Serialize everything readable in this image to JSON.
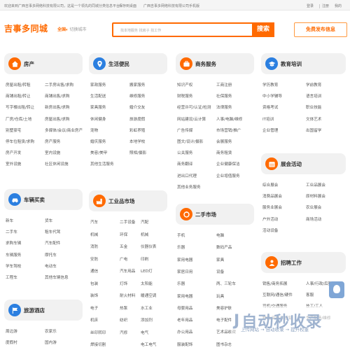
{
  "topbar": {
    "welcome": "欢迎来到广西吉事多网络科技有限公司，这是一个领先的同城分类信息平台！",
    "favorite": "保存到桌面",
    "mobile": "广西吉事多网络科技有限公司手机版",
    "login": "登录",
    "register": "注册",
    "my": "我的"
  },
  "header": {
    "logo": "吉事多同城",
    "city": "全国",
    "city_switch": "切换城市",
    "search_placeholder": "找本地服务 找房子 找工作",
    "search_button": "搜索",
    "post_button": "免费发布信息"
  },
  "cards": [
    {
      "title": "房产",
      "icon": "house-icon",
      "color": "#ff6a00",
      "items": [
        [
          "房屋出租/转租",
          "二手房出售/求购"
        ],
        [
          "商铺出租/转让",
          "商铺出售/求购"
        ],
        [
          "写字楼出租/转让",
          "新房出售/求购"
        ],
        [
          "厂房/仓库/土地",
          "房屋出售/求购"
        ],
        [
          "别墅豪宅",
          "多媒体/会议/商业房产"
        ],
        [
          "停车位租赁/求购",
          "房产服务"
        ],
        [
          "房产开发",
          "室内设施"
        ],
        [
          "室外设施",
          "社区休闲设施"
        ]
      ]
    },
    {
      "title": "生活便民",
      "icon": "location-icon",
      "color": "#2b7fe0",
      "items": [
        [
          "家政服务",
          "搬家服务"
        ],
        [
          "生活配送",
          "维修服务"
        ],
        [
          "家具服务",
          "婚介交友"
        ],
        [
          "休闲健身",
          "旅游度假"
        ],
        [
          "宠物",
          "彩虹养殖"
        ],
        [
          "婚庆服务",
          "本地学校"
        ],
        [
          "美容/美甲",
          "照相/摄影"
        ],
        [
          "其他生活服务",
          ""
        ]
      ]
    },
    {
      "title": "商务服务",
      "icon": "briefcase-icon",
      "color": "#ff6a00",
      "items": [
        [
          "知识产权",
          "工商注册"
        ],
        [
          "财税服务",
          "社保服务"
        ],
        [
          "经营许可/认证/检测",
          "法律服务"
        ],
        [
          "网站建设/云计算",
          "人事/电脑/维修"
        ],
        [
          "广告传媒",
          "市场营销/推广"
        ],
        [
          "图文/设计/摄影",
          "会展服务"
        ],
        [
          "公关服务",
          "商务租赁"
        ],
        [
          "商务翻译",
          "企业健康保洁"
        ],
        [
          "进出口代理",
          "企业增值服务"
        ],
        [
          "其他业务服务",
          ""
        ]
      ]
    },
    {
      "title": "教育培训",
      "icon": "graduation-icon",
      "color": "#2b7fe0",
      "items": [
        [
          "学历教育",
          "学前教育"
        ],
        [
          "中小学辅导",
          "语言培训"
        ],
        [
          "资格考试",
          "职业技能"
        ],
        [
          "IT培训",
          "文体艺术"
        ],
        [
          "企业管理",
          "出国留学"
        ]
      ]
    },
    {
      "title": "车辆买卖",
      "icon": "car-icon",
      "color": "#2b7fe0",
      "items": [
        [
          "新车",
          "货车"
        ],
        [
          "二手车",
          "租车代驾"
        ],
        [
          "求购车辆",
          "汽车配件"
        ],
        [
          "车辆服务",
          "摩托车"
        ],
        [
          "学车驾校",
          "电动车"
        ],
        [
          "工程车",
          "其他车辆信息"
        ]
      ]
    },
    {
      "title": "工业品市场",
      "icon": "factory-icon",
      "color": "#ff6a00",
      "items": [
        [
          "汽车",
          "二手设备",
          "汽配"
        ],
        [
          "机械",
          "环保",
          "机械"
        ],
        [
          "消防",
          "五金",
          "仪器仪表"
        ],
        [
          "安防",
          "广电",
          "印刷"
        ],
        [
          "通信",
          "汽车用品",
          "LED灯"
        ],
        [
          "包装",
          "灯饰",
          "太阳能"
        ],
        [
          "装饰",
          "耐火材料",
          "暖通空调"
        ],
        [
          "电子",
          "热泵",
          "水工业"
        ],
        [
          "机床",
          "纺织",
          "添加剂"
        ],
        [
          "丝印转印",
          "汽修",
          "电气"
        ],
        [
          "焊接切割",
          "",
          "电工电气"
        ]
      ]
    },
    {
      "title": "二手市场",
      "icon": "recycle-icon",
      "color": "#ff6a00",
      "items": [
        [
          "手机",
          "电脑"
        ],
        [
          "乐器",
          "数码产品"
        ],
        [
          "家用电器",
          "家具"
        ],
        [
          "家居日用",
          "设备"
        ],
        [
          "乐器",
          "两、三轮车"
        ],
        [
          "家用电器",
          "玩具"
        ],
        [
          "母婴用品",
          "美容护肤"
        ],
        [
          "老年用品",
          "电子配件"
        ],
        [
          "办公用品",
          "艺术品收藏"
        ],
        [
          "服装配饰",
          "图书杂志"
        ]
      ]
    },
    {
      "title": "展会活动",
      "icon": "calendar-icon",
      "color": "#ff6a00",
      "items": [
        [
          "综合展会",
          "工业品展会"
        ],
        [
          "消费品展会",
          "原材料展会"
        ],
        [
          "服务业展会",
          "农业展会"
        ],
        [
          "户外活动",
          "商场活动"
        ],
        [
          "活动设备",
          ""
        ]
      ]
    },
    {
      "title": "招聘工作",
      "icon": "person-icon",
      "color": "#ff6a00",
      "items": [
        [
          "销售/商务拓展",
          "人事/行政/后勤"
        ],
        [
          "互联网/通信/硬件",
          "客服"
        ],
        [
          "司机/交通服务",
          "技工/工人"
        ],
        [
          "物流/采购/供应链",
          "生产制造/维修"
        ]
      ]
    },
    {
      "title": "旅游酒店",
      "icon": "flag-icon",
      "color": "#2b7fe0",
      "items": [
        [
          "周边游",
          "农家乐"
        ],
        [
          "度假村",
          "国内游"
        ]
      ]
    }
  ],
  "watermark": {
    "brand": "自动秒收录",
    "tagline": "上传网站 → 自动收录 → 提升权重"
  }
}
